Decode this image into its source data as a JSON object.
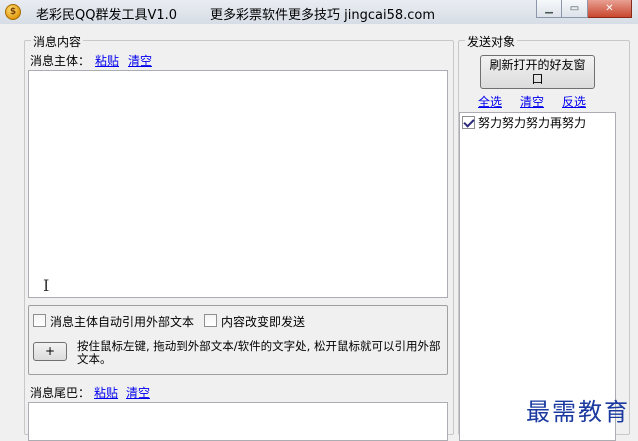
{
  "window": {
    "title": "老彩民QQ群发工具V1.0",
    "title_extra": "更多彩票软件更多技巧 jingcai58.com",
    "icon": "coin-icon",
    "minimize_glyph": "▁",
    "maximize_glyph": "▭",
    "close_glyph": "✕"
  },
  "message_group": {
    "title": "消息内容",
    "body_label": "消息主体：",
    "paste_link": "粘贴",
    "clear_link": "清空",
    "body_value": "",
    "auto_ref_label": "消息主体自动引用外部文本",
    "auto_ref_checked": false,
    "send_on_change_label": "内容改变即发送",
    "send_on_change_checked": false,
    "drag_button_label": "+",
    "hint_text": "按住鼠标左键, 拖动到外部文本/软件的文字处, 松开鼠标就可以引用外部文本。",
    "tail_label": "消息尾巴：",
    "tail_paste_link": "粘贴",
    "tail_clear_link": "清空",
    "tail_value": ""
  },
  "targets_group": {
    "title": "发送对象",
    "refresh_button": "刷新打开的好友窗口",
    "select_all": "全选",
    "clear": "清空",
    "invert": "反选",
    "items": [
      {
        "label": "努力努力努力再努力",
        "checked": true
      }
    ]
  },
  "watermark": "最需教育"
}
